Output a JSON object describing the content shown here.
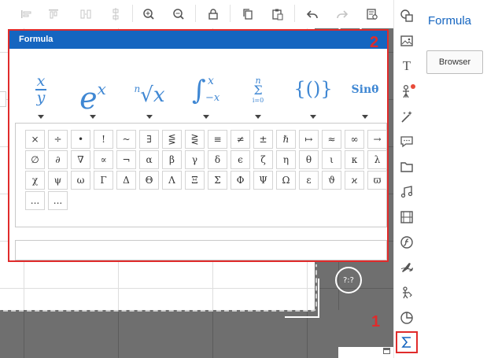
{
  "toolbar": {
    "icons": [
      "align-left-icon",
      "align-top-icon",
      "distribute-horizontal-icon",
      "distribute-vertical-icon",
      "zoom-in-icon",
      "zoom-out-icon",
      "lock-icon",
      "copy-icon",
      "paste-icon",
      "undo-icon",
      "redo-icon",
      "preview-icon"
    ]
  },
  "formula_panel": {
    "title": "Formula",
    "templates": [
      {
        "icon": "fraction-icon",
        "top": "x",
        "bottom": "y"
      },
      {
        "icon": "exponent-icon",
        "base": "e",
        "sup": "x"
      },
      {
        "icon": "radical-icon",
        "index": "n",
        "radicand": "x"
      },
      {
        "icon": "integral-icon",
        "sup": "x",
        "sub": "−x"
      },
      {
        "icon": "summation-icon",
        "upper": "n",
        "symbol": "Σ",
        "lower": "i=0"
      },
      {
        "icon": "brackets-icon",
        "text": "{()}"
      },
      {
        "icon": "trig-icon",
        "text": "Sinθ"
      }
    ],
    "symbols": [
      "×",
      "÷",
      "•",
      "!",
      "~",
      "∃",
      "⋚",
      "⋛",
      "≡",
      "≠",
      "±",
      "ℏ",
      "↦",
      "≈",
      "∞",
      "→",
      "∅",
      "∂",
      "∇",
      "∝",
      "¬",
      "α",
      "β",
      "γ",
      "δ",
      "ϵ",
      "ζ",
      "η",
      "θ",
      "ι",
      "κ",
      "λ",
      "χ",
      "ψ",
      "ω",
      "Γ",
      "Δ",
      "Θ",
      "Λ",
      "Ξ",
      "Σ",
      "Φ",
      "Ψ",
      "Ω",
      "ε",
      "ϑ",
      "ϰ",
      "ϖ",
      "...",
      "..."
    ],
    "input_value": ""
  },
  "canvas": {
    "help_text": "?:?"
  },
  "callouts": {
    "one": "1",
    "two": "2"
  },
  "side_icons": [
    "shapes-icon",
    "image-icon",
    "text-icon",
    "character-icon",
    "effects-icon",
    "speech-bubble-icon",
    "folder-icon",
    "music-icon",
    "video-icon",
    "flash-icon",
    "plane-icon",
    "svg-icon",
    "chart-icon",
    "formula-icon"
  ],
  "properties": {
    "title": "Formula",
    "browser_label": "Browser"
  },
  "colors": {
    "accent": "#1565c0",
    "highlight": "#e02b2b",
    "template_blue": "#3f87d3"
  }
}
